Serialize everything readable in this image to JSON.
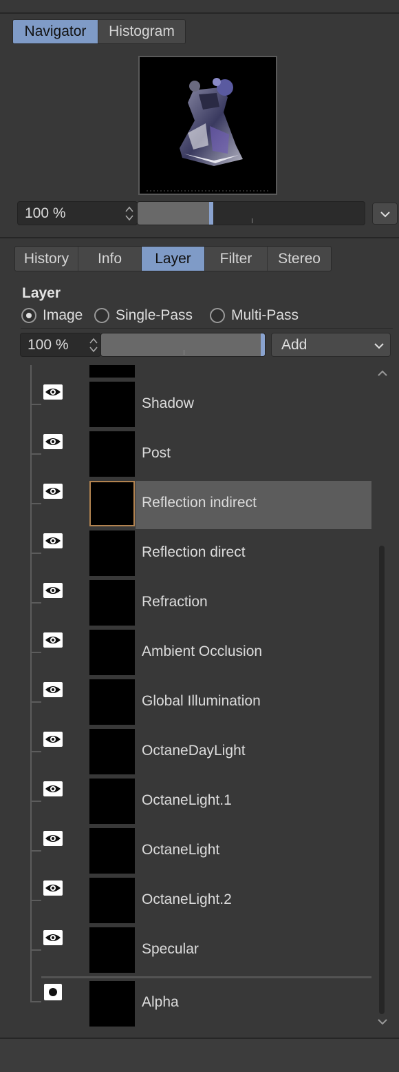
{
  "navigator": {
    "tabs": [
      {
        "label": "Navigator",
        "active": true
      },
      {
        "label": "Histogram",
        "active": false
      }
    ],
    "zoom_value": "100 %",
    "zoom_level": 0.32
  },
  "panel_tabs": [
    {
      "label": "History",
      "active": false
    },
    {
      "label": "Info",
      "active": false
    },
    {
      "label": "Layer",
      "active": true
    },
    {
      "label": "Filter",
      "active": false
    },
    {
      "label": "Stereo",
      "active": false
    }
  ],
  "layer": {
    "heading": "Layer",
    "modes": [
      {
        "label": "Image",
        "selected": true
      },
      {
        "label": "Single-Pass",
        "selected": false
      },
      {
        "label": "Multi-Pass",
        "selected": false
      }
    ],
    "opacity_value": "100 %",
    "opacity_level": 1.0,
    "blend_mode": "Add",
    "items": [
      {
        "name": "Shadow",
        "icon": "eye-icon"
      },
      {
        "name": "Post",
        "icon": "eye-icon"
      },
      {
        "name": "Reflection indirect",
        "icon": "eye-icon",
        "selected": true
      },
      {
        "name": "Reflection direct",
        "icon": "eye-icon"
      },
      {
        "name": "Refraction",
        "icon": "eye-icon"
      },
      {
        "name": "Ambient Occlusion",
        "icon": "eye-icon"
      },
      {
        "name": "Global Illumination",
        "icon": "eye-icon"
      },
      {
        "name": "OctaneDayLight",
        "icon": "eye-icon"
      },
      {
        "name": "OctaneLight.1",
        "icon": "eye-icon"
      },
      {
        "name": "OctaneLight",
        "icon": "eye-icon"
      },
      {
        "name": "OctaneLight.2",
        "icon": "eye-icon"
      },
      {
        "name": "Specular",
        "icon": "eye-icon"
      }
    ],
    "alpha": {
      "name": "Alpha",
      "icon": "dot-icon"
    }
  },
  "colors": {
    "background": "#383838",
    "active_tab": "#7f9bc7",
    "selected_row": "#5c5c5c",
    "selected_thumb_border": "#b28350"
  }
}
